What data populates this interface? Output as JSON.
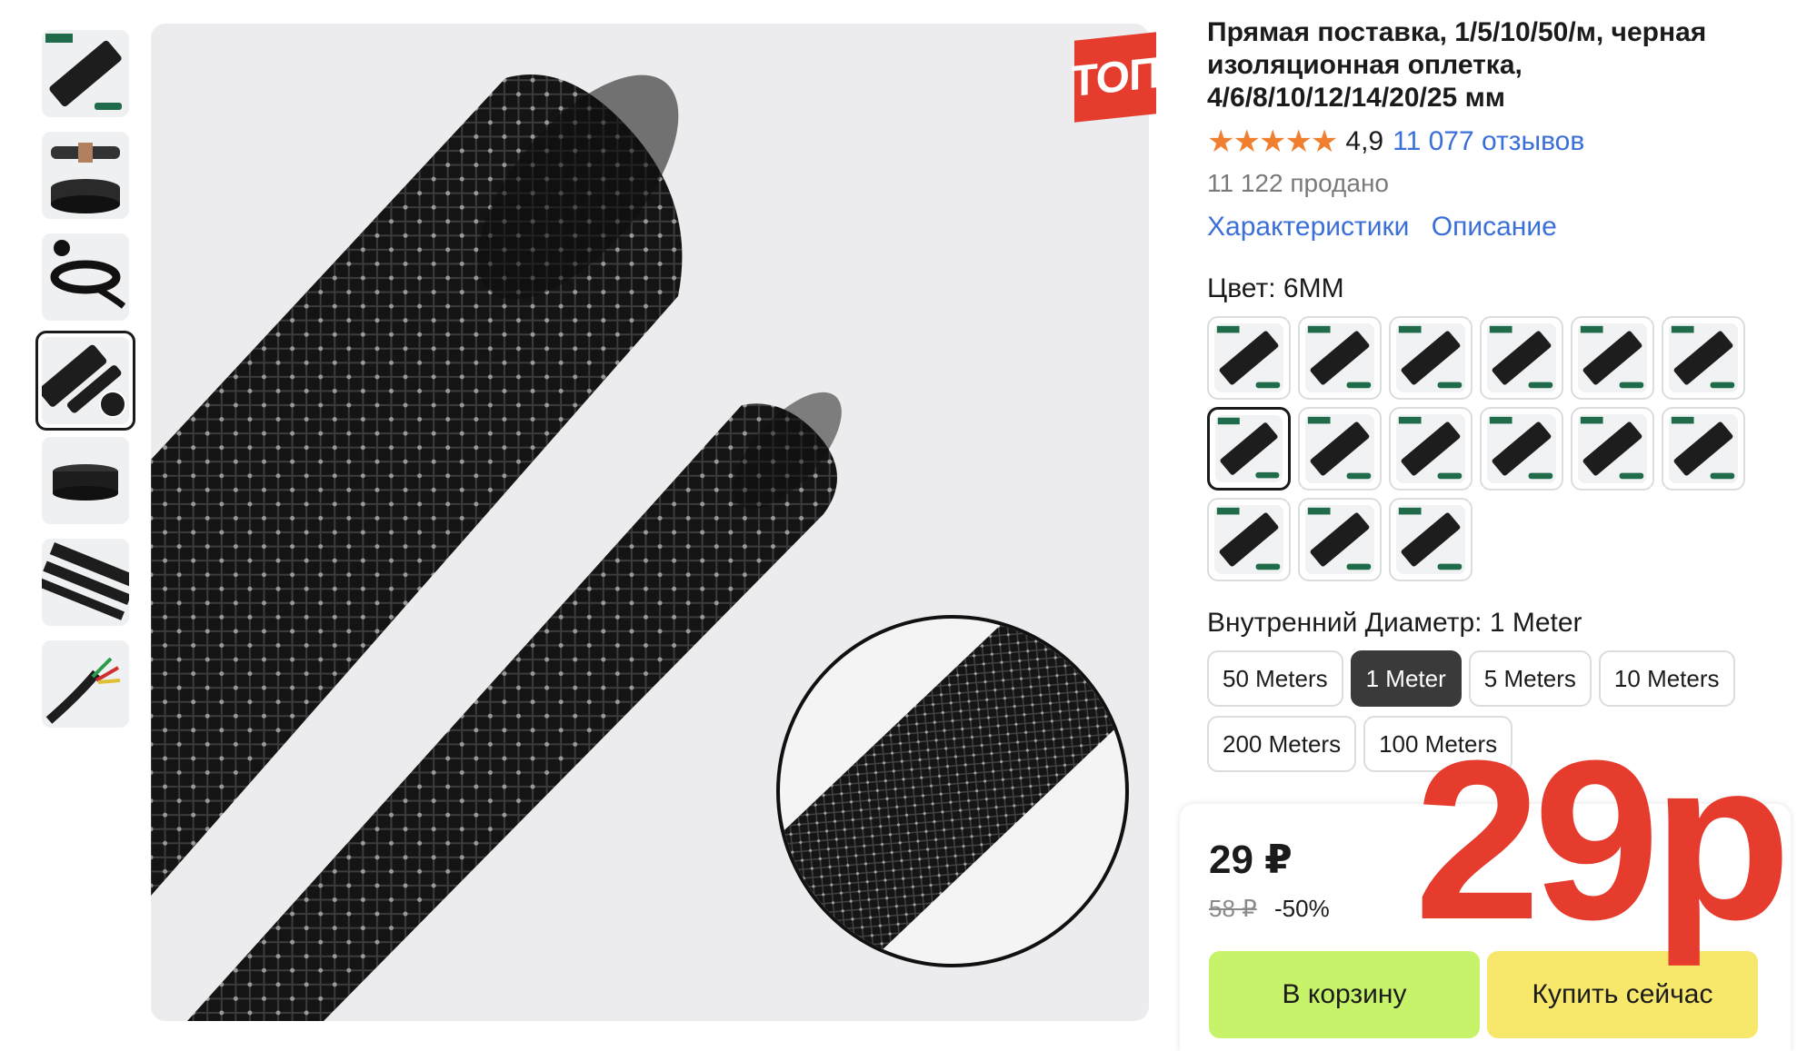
{
  "product": {
    "title": "Прямая поставка, 1/5/10/50/м, черная изоляционная оплетка, 4/6/8/10/12/14/20/25 мм",
    "rating": "4,9",
    "stars": "★★★★★",
    "reviews": "11 077 отзывов",
    "sold": "11 122 продано"
  },
  "links": {
    "characteristics": "Характеристики",
    "description": "Описание"
  },
  "badge": {
    "top": "ТОП"
  },
  "color": {
    "label": "Цвет: 6MM",
    "selected_index": 6,
    "swatch_count": 15
  },
  "diameter": {
    "label": "Внутренний Диаметр: 1 Meter",
    "options": [
      "50 Meters",
      "1 Meter",
      "5 Meters",
      "10 Meters",
      "200 Meters",
      "100 Meters"
    ],
    "selected_index": 1
  },
  "price": {
    "current": "29 ₽",
    "old": "58 ₽",
    "discount": "-50%",
    "overlay": "29р"
  },
  "buttons": {
    "cart": "В корзину",
    "buy": "Купить сейчас"
  },
  "thumbnails": {
    "count": 7,
    "active_index": 3
  },
  "colors": {
    "accent_link": "#3b6fd8",
    "star": "#f07f2f",
    "badge": "#e53c2e",
    "cart_button": "#c7f36a",
    "buy_button": "#f7e76b",
    "selected_option": "#3a3a3a"
  }
}
